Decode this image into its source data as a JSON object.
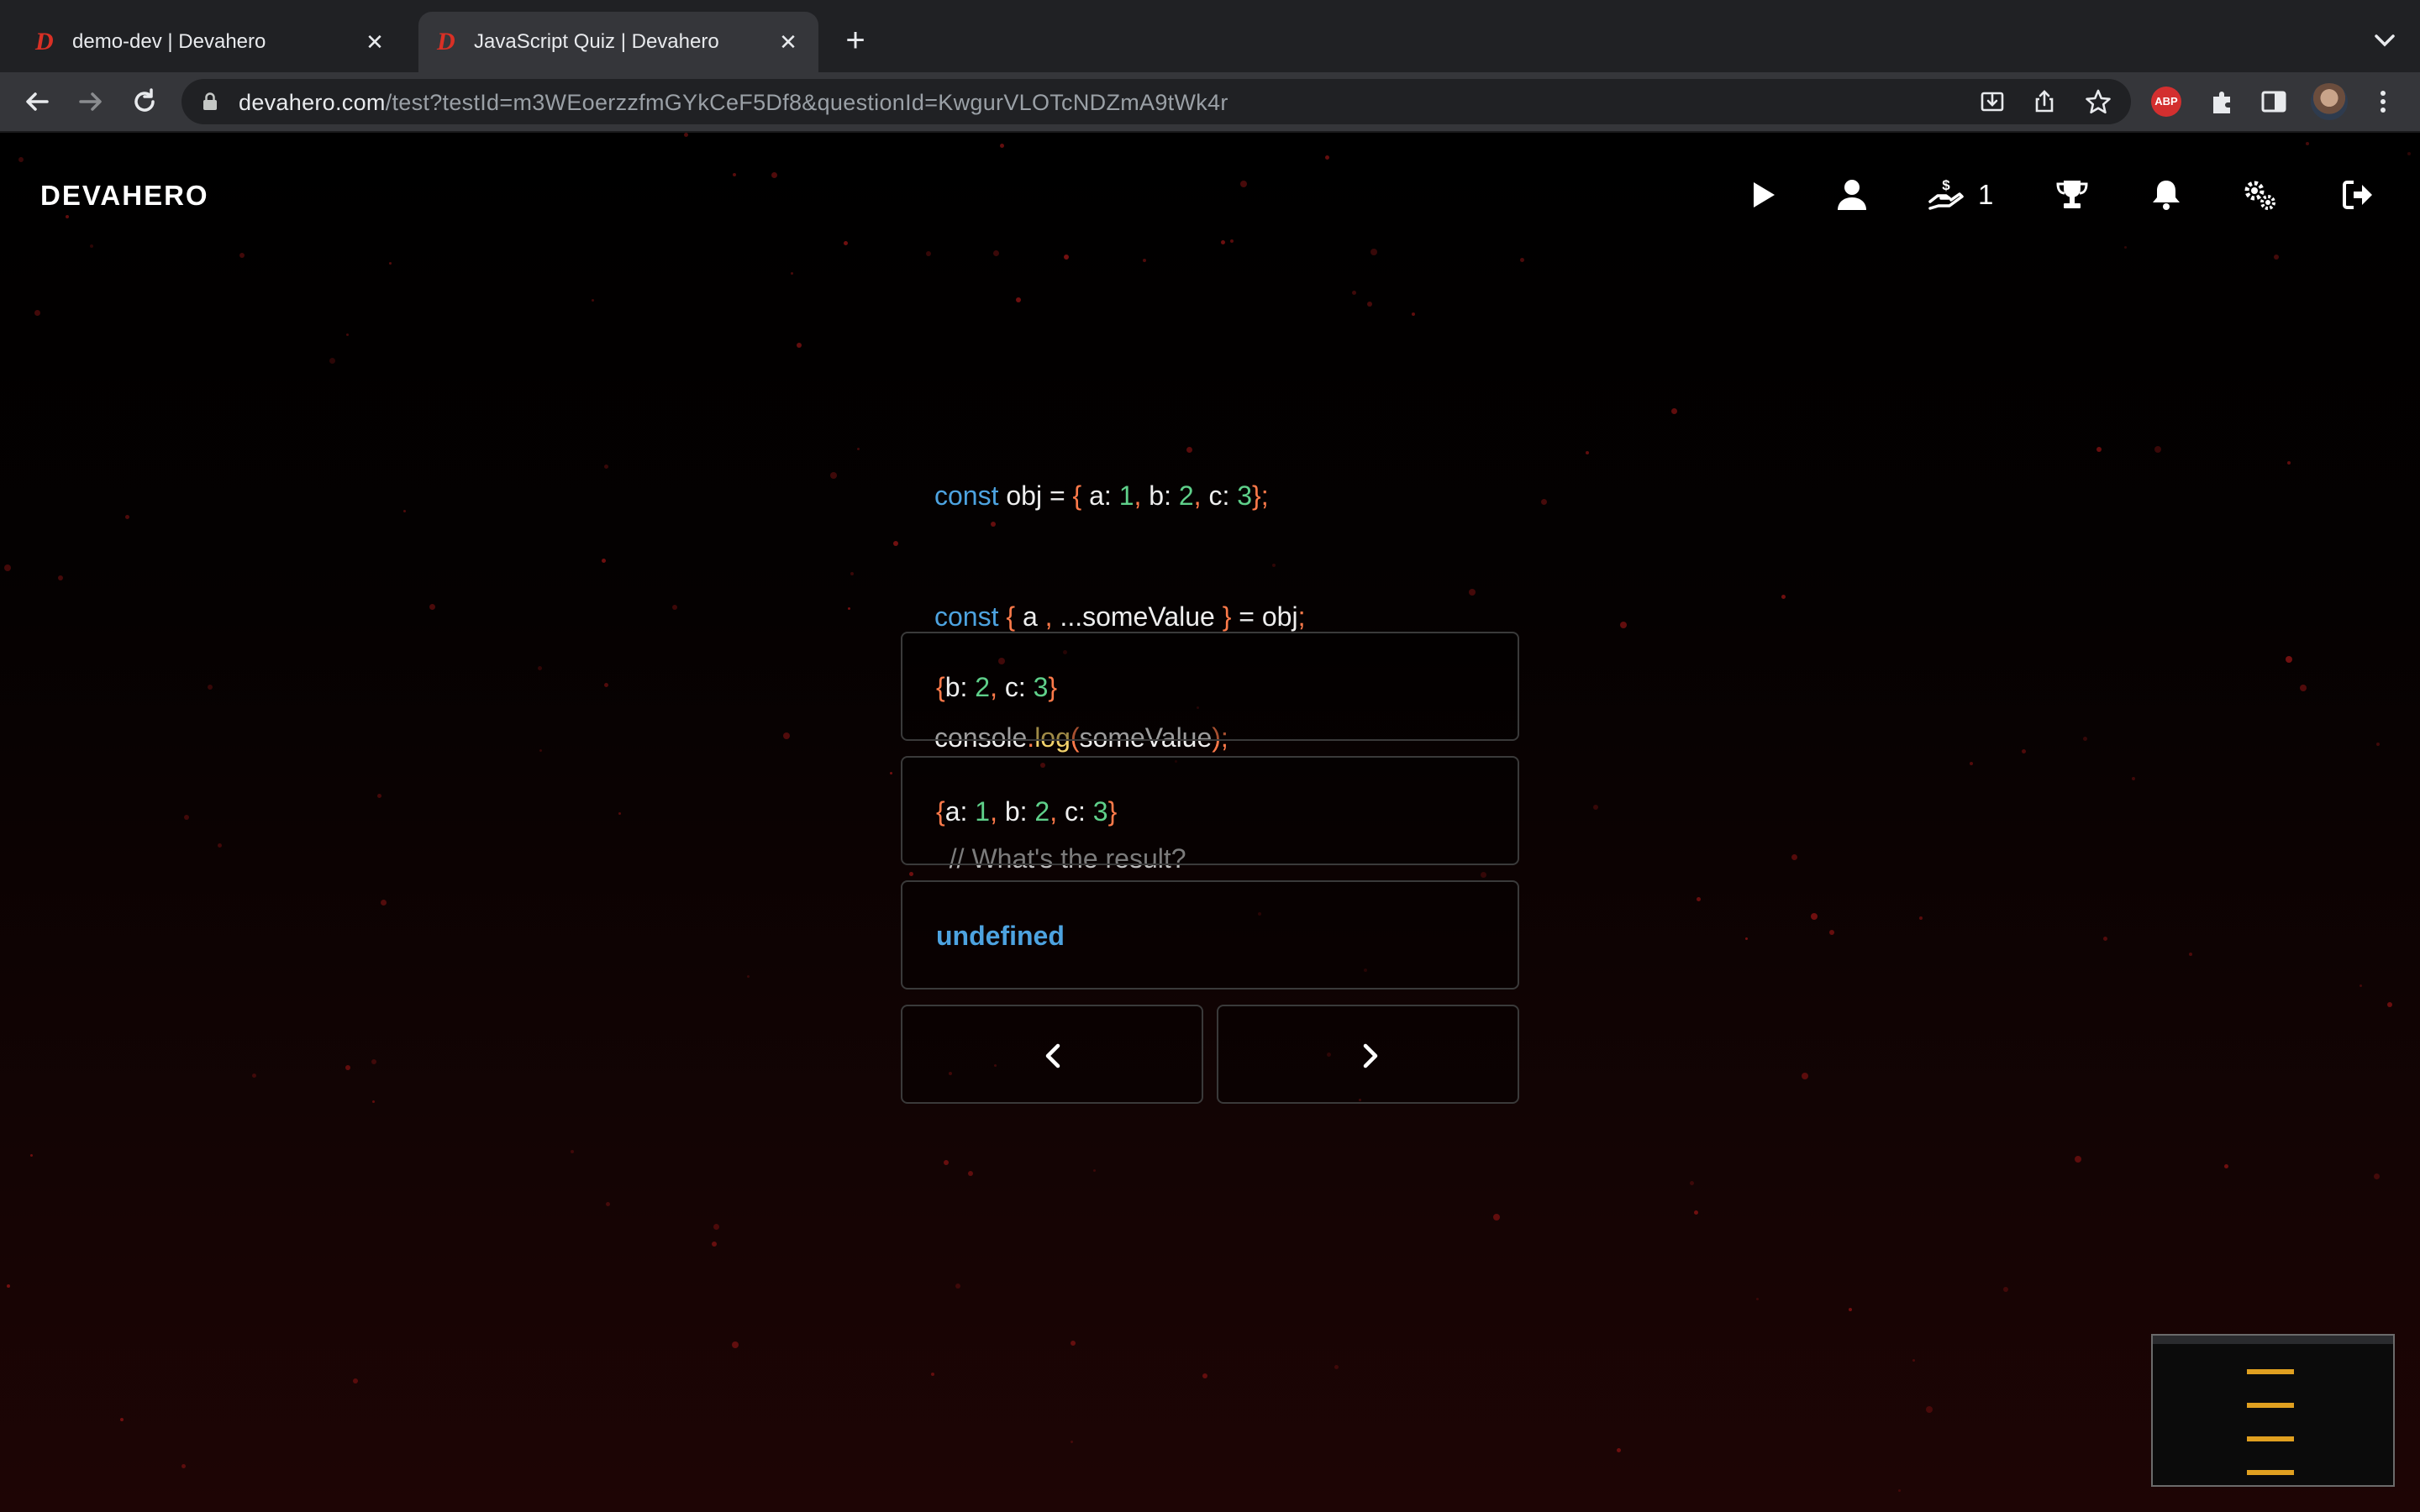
{
  "browser": {
    "tabs": [
      {
        "favicon": "D",
        "title": "demo-dev | Devahero",
        "active": false
      },
      {
        "favicon": "D",
        "title": "JavaScript Quiz | Devahero",
        "active": true
      }
    ],
    "new_tab_label": "+",
    "close_label": "✕",
    "url_host": "devahero.com",
    "url_path": "/test?testId=m3WEoerzzfmGYkCeF5Df8&questionId=KwgurVLOTcNDZmA9tWk4r",
    "abp_label": "ABP",
    "icons": [
      "back-icon",
      "forward-icon",
      "reload-icon",
      "lock-icon",
      "install-icon",
      "share-icon",
      "bookmark-star-icon",
      "adblock-icon",
      "extensions-icon",
      "sidepanel-icon",
      "profile-avatar",
      "menu-icon"
    ]
  },
  "header": {
    "logo": "DEVAHERO",
    "credits": "1",
    "icons": [
      "play-icon",
      "user-icon",
      "coin-hand-icon",
      "trophy-icon",
      "bell-icon",
      "settings-icon",
      "logout-icon"
    ]
  },
  "question": {
    "line1": {
      "kw": "const",
      "name": " obj = ",
      "open": "{",
      "a": " a: ",
      "v1": "1",
      "c1": ",",
      "b": " b: ",
      "v2": "2",
      "c2": ",",
      "c": " c: ",
      "v3": "3",
      "close": "}",
      "semi": ";"
    },
    "line2": {
      "kw": "const",
      "sp": " ",
      "open": "{",
      "a": " a ",
      "comma": ",",
      "rest": " ...someValue ",
      "close": "}",
      "tail": " = obj",
      "semi": ";"
    },
    "line3": {
      "obj": "console",
      "dot": ".",
      "fn": "log",
      "open": "(",
      "arg": "someValue",
      "close": ")",
      "semi": ";"
    },
    "line4": {
      "comment": "  // What's the result?"
    }
  },
  "answers": [
    {
      "open": "{",
      "b": "b: ",
      "v2": "2",
      "c1": ",",
      "c": " c: ",
      "v3": "3",
      "close": "}"
    },
    {
      "open": "{",
      "a": "a: ",
      "v1": "1",
      "c1": ",",
      "b": " b: ",
      "v2": "2",
      "c2": ",",
      "c": " c: ",
      "v3": "3",
      "close": "}"
    },
    {
      "text": "undefined"
    }
  ],
  "navigation": {
    "prev": "previous-chevron-icon",
    "next": "next-chevron-icon"
  },
  "colors": {
    "keyword": "#4da3e0",
    "punctuation": "#ff7a4a",
    "number": "#5fd08a",
    "function": "#f3d36c",
    "particles": "#7a1111"
  }
}
